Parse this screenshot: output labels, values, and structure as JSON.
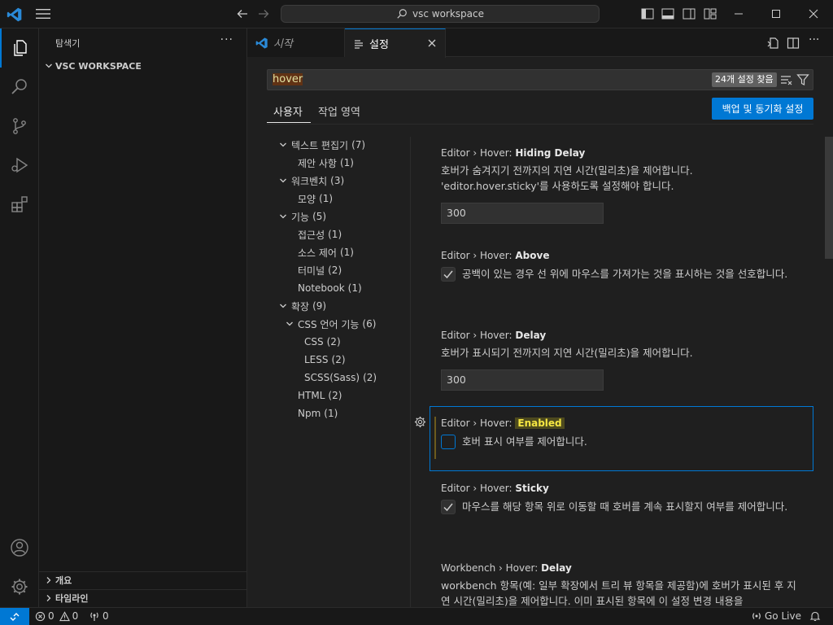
{
  "titlebar": {
    "search_text": "vsc workspace"
  },
  "sidebar": {
    "title": "탐색기",
    "more": "···",
    "workspace": "VSC WORKSPACE",
    "outline": "개요",
    "timeline": "타임라인"
  },
  "tabs": [
    {
      "label": "시작",
      "icon": "vscode-logo-icon"
    },
    {
      "label": "설정",
      "icon": "settings-file-icon"
    }
  ],
  "settings": {
    "search_value": "hover",
    "result_count": "24개 설정 찾음",
    "scope_tabs": [
      "사용자",
      "작업 영역"
    ],
    "sync_button": "백업 및 동기화 설정"
  },
  "toc": [
    {
      "label": "텍스트 편집기",
      "count": "(7)",
      "level": 0,
      "expandable": true
    },
    {
      "label": "제안 사항",
      "count": "(1)",
      "level": 1,
      "expandable": false
    },
    {
      "label": "워크벤치",
      "count": "(3)",
      "level": 0,
      "expandable": true
    },
    {
      "label": "모양",
      "count": "(1)",
      "level": 1,
      "expandable": false
    },
    {
      "label": "기능",
      "count": "(5)",
      "level": 0,
      "expandable": true
    },
    {
      "label": "접근성",
      "count": "(1)",
      "level": 1,
      "expandable": false
    },
    {
      "label": "소스 제어",
      "count": "(1)",
      "level": 1,
      "expandable": false
    },
    {
      "label": "터미널",
      "count": "(2)",
      "level": 1,
      "expandable": false
    },
    {
      "label": "Notebook",
      "count": "(1)",
      "level": 1,
      "expandable": false
    },
    {
      "label": "확장",
      "count": "(9)",
      "level": 0,
      "expandable": true
    },
    {
      "label": "CSS 언어 기능",
      "count": "(6)",
      "level": 1,
      "expandable": true
    },
    {
      "label": "CSS",
      "count": "(2)",
      "level": 2,
      "expandable": false
    },
    {
      "label": "LESS",
      "count": "(2)",
      "level": 2,
      "expandable": false
    },
    {
      "label": "SCSS(Sass)",
      "count": "(2)",
      "level": 2,
      "expandable": false
    },
    {
      "label": "HTML",
      "count": "(2)",
      "level": 1,
      "expandable": false
    },
    {
      "label": "Npm",
      "count": "(1)",
      "level": 1,
      "expandable": false
    }
  ],
  "items": [
    {
      "prefix": "Editor › Hover: ",
      "name": "Hiding Delay",
      "desc": "호버가 숨겨지기 전까지의 지연 시간(밀리초)을 제어합니다. 'editor.hover.sticky'를 사용하도록 설정해야 합니다.",
      "value": "300"
    },
    {
      "prefix": "Editor › Hover: ",
      "name": "Above",
      "desc": "공백이 있는 경우 선 위에 마우스를 가져가는 것을 표시하는 것을 선호합니다.",
      "checked": true
    },
    {
      "prefix": "Editor › Hover: ",
      "name": "Delay",
      "desc": "호버가 표시되기 전까지의 지연 시간(밀리초)을 제어합니다.",
      "value": "300"
    },
    {
      "prefix": "Editor › Hover: ",
      "name": "Enabled",
      "desc": "호버 표시 여부를 제어합니다.",
      "checked": false
    },
    {
      "prefix": "Editor › Hover: ",
      "name": "Sticky",
      "desc": "마우스를 해당 항목 위로 이동할 때 호버를 계속 표시할지 여부를 제어합니다.",
      "checked": true
    },
    {
      "prefix": "Workbench › Hover: ",
      "name": "Delay",
      "desc": "workbench 항목(예: 일부 확장에서 트리 뷰 항목을 제공함)에 호버가 표시된 후 지연 시간(밀리초)을 제어합니다. 이미 표시된 항목에 이 설정 변경 내용을"
    }
  ],
  "statusbar": {
    "errors": "0",
    "warnings": "0",
    "ports": "0",
    "golive": "Go Live"
  },
  "colors": {
    "accent": "#0078d4",
    "highlight": "#f5e642"
  }
}
